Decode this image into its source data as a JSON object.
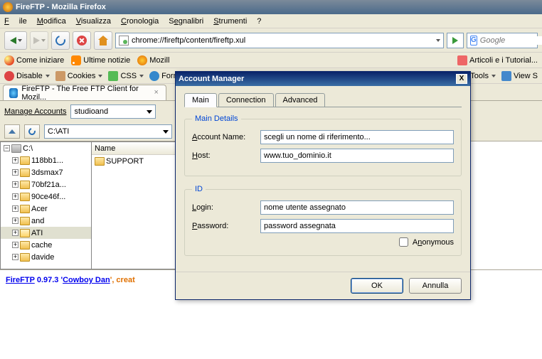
{
  "window": {
    "title": "FireFTP - Mozilla Firefox"
  },
  "menu": {
    "file": "File",
    "edit": "Modifica",
    "view": "Visualizza",
    "history": "Cronologia",
    "bookmarks": "Segnalibri",
    "tools": "Strumenti",
    "help": "?"
  },
  "url": {
    "value": "chrome://fireftp/content/fireftp.xul"
  },
  "search": {
    "placeholder": "Google"
  },
  "bookmarks": {
    "b1": "Come iniziare",
    "b2": "Ultime notizie",
    "b3": "Mozill",
    "b4": "Articoli e i Tutorial..."
  },
  "devbar": {
    "disable": "Disable",
    "cookies": "Cookies",
    "css": "CSS",
    "form": "Form",
    "tools": "Tools",
    "views": "View S"
  },
  "tab": {
    "title": "FireFTP - The Free FTP Client for Mozil..."
  },
  "ftp": {
    "manage": "Manage Accounts",
    "account": "studioand",
    "path": "C:\\ATI"
  },
  "tree": {
    "root": "C:\\",
    "nodes": [
      "118bb1...",
      "3dsmax7",
      "70bf21a...",
      "90ce46f...",
      "Acer",
      "and",
      "ATI",
      "cache",
      "davide"
    ],
    "right_header": "Name",
    "right_item": "SUPPORT"
  },
  "status": {
    "app": "FireFTP",
    "ver": " 0.97.3 '",
    "name": "Cowboy Dan",
    "rest": "', creat"
  },
  "dialog": {
    "title": "Account Manager",
    "tabs": {
      "main": "Main",
      "connection": "Connection",
      "advanced": "Advanced"
    },
    "main_legend": "Main Details",
    "account_label": "Account Name:",
    "account_val": "scegli un nome di riferimento...",
    "host_label": "Host:",
    "host_val": "www.tuo_dominio.it",
    "id_legend": "ID",
    "login_label": "Login:",
    "login_val": "nome utente assegnato",
    "pass_label": "Password:",
    "pass_val": "password assegnata",
    "anon": "Anonymous",
    "ok": "OK",
    "cancel": "Annulla"
  }
}
